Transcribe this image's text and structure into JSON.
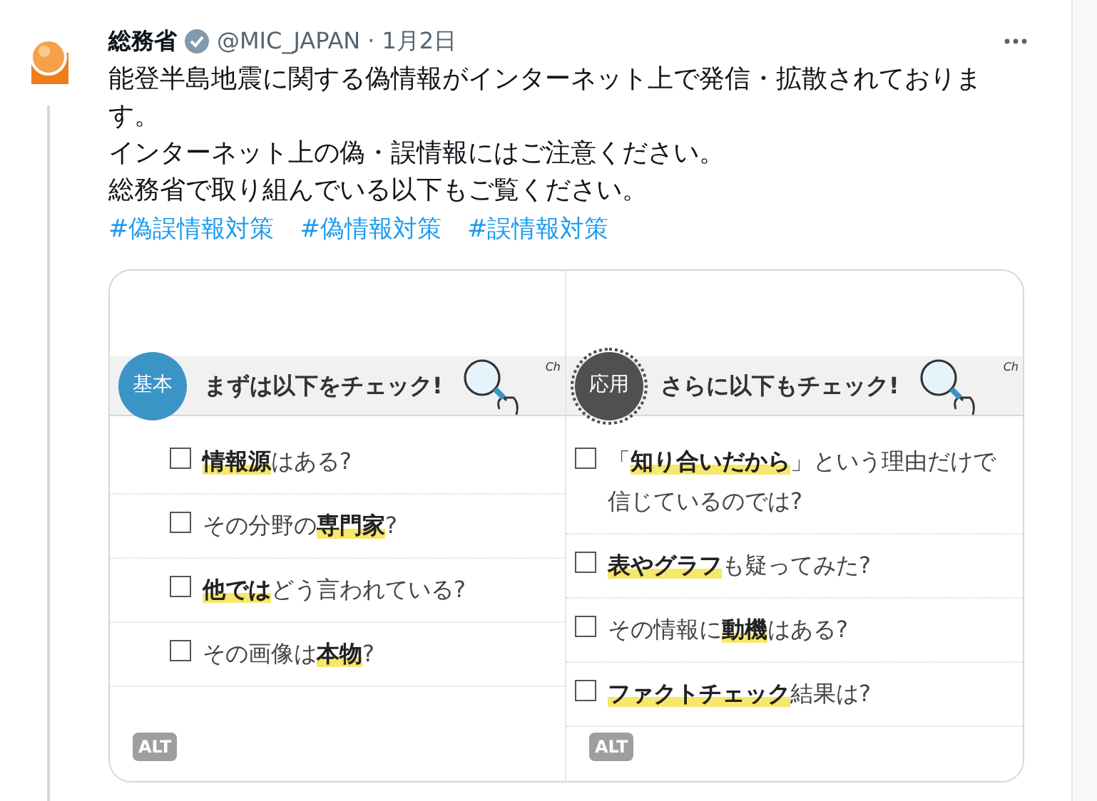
{
  "post": {
    "author": "総務省",
    "verified": true,
    "handle": "@MIC_JAPAN",
    "separator": "·",
    "date": "1月2日",
    "body": [
      "能登半島地震に関する偽情報がインターネット上で発信・拡散されております。",
      "インターネット上の偽・誤情報にはご注意ください。",
      "総務省で取り組んでいる以下もご覧ください。"
    ],
    "hashtags": [
      "#偽誤情報対策",
      "#偽情報対策",
      "#誤情報対策"
    ],
    "images": [
      {
        "badge": "基本",
        "kind": "circle",
        "title": "まずは以下をチェック!",
        "tag": "Ch",
        "alt": "ALT",
        "items": [
          {
            "text": "**情報源**はある?",
            "checked": false
          },
          {
            "text": "その分野の**専門家**?",
            "checked": false
          },
          {
            "text": "**他では**どう言われている?",
            "checked": false
          },
          {
            "text": "その画像は**本物**?",
            "checked": false
          }
        ]
      },
      {
        "badge": "応用",
        "kind": "seal",
        "title": "さらに以下もチェック!",
        "tag": "Ch",
        "alt": "ALT",
        "items": [
          {
            "text": "「**知り合いだから**」という理由だけで信じているのでは?",
            "checked": false
          },
          {
            "text": "**表やグラフ**も疑ってみた?",
            "checked": false
          },
          {
            "text": "その情報に**動機**はある?",
            "checked": false
          },
          {
            "text": "**ファクトチェック**結果は?",
            "checked": false
          }
        ]
      }
    ]
  }
}
